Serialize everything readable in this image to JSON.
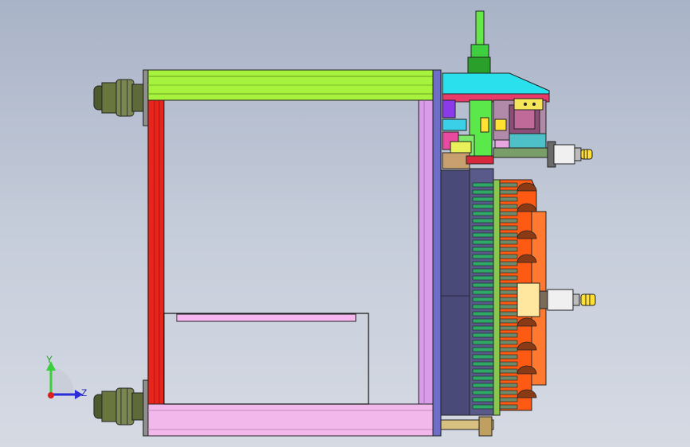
{
  "view": {
    "background_top": "#a9b3c7",
    "background_bottom": "#d5dae3"
  },
  "triad": {
    "y_label": "Y",
    "z_label": "Z",
    "y_color": "#3ccf3c",
    "z_color": "#2b2bd8",
    "x_color": "#d82020"
  },
  "colors": {
    "top_rail": "#a6f23c",
    "bottom_rail": "#f2b8ec",
    "left_post": "#e8241c",
    "right_post": "#d89ce8",
    "back_plate": "#6e6ec8",
    "dark_panel": "#4a4a78",
    "cyan_block": "#29e0ec",
    "orange_plate": "#ff5a14",
    "green_rod": "#66e84a",
    "yellow_fitting": "#ffe033",
    "pink_bar": "#f6b6f0",
    "wheel": "#5e6a3a"
  },
  "icons": [
    "caster-wheel",
    "coordinate-triad",
    "air-cylinder"
  ]
}
